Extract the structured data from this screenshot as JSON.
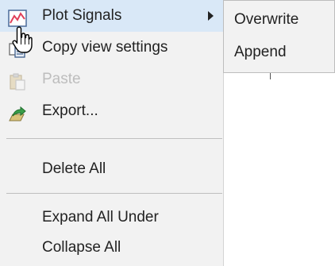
{
  "context_menu": {
    "items": [
      {
        "label": "Plot Signals",
        "icon": "plot-signals-icon",
        "state": "highlighted",
        "has_submenu": true
      },
      {
        "label": "Copy view settings",
        "icon": "copy-view-settings-icon",
        "state": "enabled"
      },
      {
        "label": "Paste",
        "icon": "paste-icon",
        "state": "disabled"
      },
      {
        "label": "Export...",
        "icon": "export-icon",
        "state": "enabled"
      },
      {
        "label": "Delete All",
        "state": "enabled"
      },
      {
        "label": "Expand All Under",
        "state": "enabled"
      },
      {
        "label": "Collapse All",
        "state": "enabled"
      }
    ]
  },
  "submenu": {
    "items": [
      {
        "label": "Overwrite"
      },
      {
        "label": "Append"
      }
    ]
  },
  "cursor": {
    "icon": "hand-pointer-icon"
  },
  "colors": {
    "menu_background": "#f2f2f2",
    "highlight": "#d9e8f7",
    "text": "#222222",
    "disabled_text": "#bdbdbd",
    "separator": "#bfbfbf"
  }
}
